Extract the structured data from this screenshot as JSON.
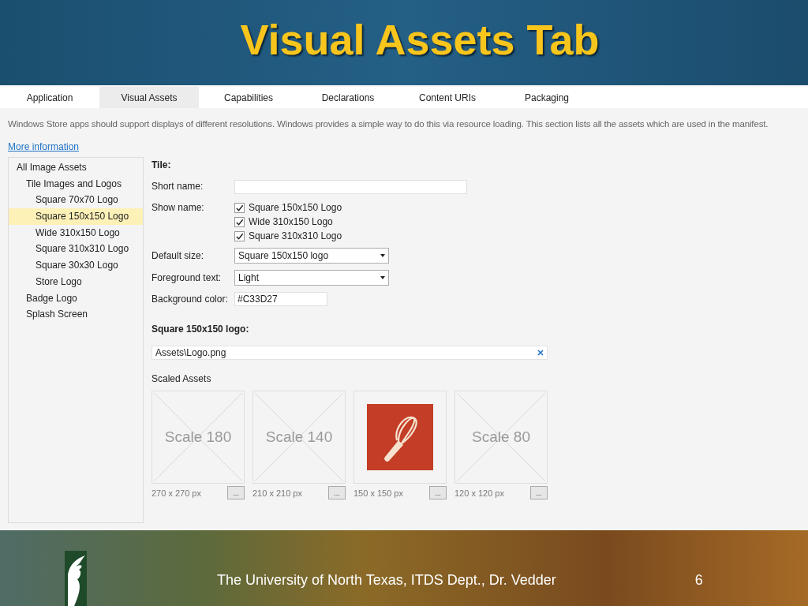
{
  "slide": {
    "title": "Visual Assets Tab",
    "footer": "The University of North Texas, ITDS Dept., Dr. Vedder",
    "page_number": "6"
  },
  "tabs": [
    {
      "label": "Application",
      "selected": false
    },
    {
      "label": "Visual Assets",
      "selected": true
    },
    {
      "label": "Capabilities",
      "selected": false
    },
    {
      "label": "Declarations",
      "selected": false
    },
    {
      "label": "Content URIs",
      "selected": false
    },
    {
      "label": "Packaging",
      "selected": false
    }
  ],
  "description": "Windows Store apps should support displays of different resolutions. Windows provides a simple way to do this via resource loading. This section lists all the assets which are used in the manifest.",
  "more_link": "More information",
  "tree": [
    {
      "label": "All Image Assets",
      "selected": false,
      "children": [
        {
          "label": "Tile Images and Logos",
          "selected": false,
          "children": [
            {
              "label": "Square 70x70 Logo",
              "selected": false
            },
            {
              "label": "Square 150x150 Logo",
              "selected": true
            },
            {
              "label": "Wide 310x150 Logo",
              "selected": false
            },
            {
              "label": "Square 310x310 Logo",
              "selected": false
            },
            {
              "label": "Square 30x30 Logo",
              "selected": false
            },
            {
              "label": "Store Logo",
              "selected": false
            }
          ]
        },
        {
          "label": "Badge Logo",
          "selected": false
        },
        {
          "label": "Splash Screen",
          "selected": false
        }
      ]
    }
  ],
  "tile": {
    "heading": "Tile:",
    "short_name": {
      "label": "Short name:"
    },
    "show_name": {
      "label": "Show name:",
      "options": [
        {
          "label": "Square 150x150 Logo",
          "checked": true
        },
        {
          "label": "Wide 310x150 Logo",
          "checked": true
        },
        {
          "label": "Square 310x310 Logo",
          "checked": true
        }
      ]
    },
    "default_size": {
      "label": "Default size:",
      "value": "Square 150x150 logo"
    },
    "foreground_text": {
      "label": "Foreground text:",
      "value": "Light"
    },
    "background_color": {
      "label": "Background color:",
      "value": "#C33D27"
    }
  },
  "logo": {
    "heading": "Square 150x150 logo:",
    "path": "Assets\\Logo.png",
    "scaled_label": "Scaled Assets",
    "assets": [
      {
        "kind": "placeholder",
        "caption": "Scale 180",
        "size": "270 x 270 px",
        "button": "..."
      },
      {
        "kind": "placeholder",
        "caption": "Scale 140",
        "size": "210 x 210 px",
        "button": "..."
      },
      {
        "kind": "image",
        "size": "150 x 150 px",
        "button": "..."
      },
      {
        "kind": "placeholder",
        "caption": "Scale 80",
        "size": "120 x 120 px",
        "button": "..."
      }
    ]
  }
}
